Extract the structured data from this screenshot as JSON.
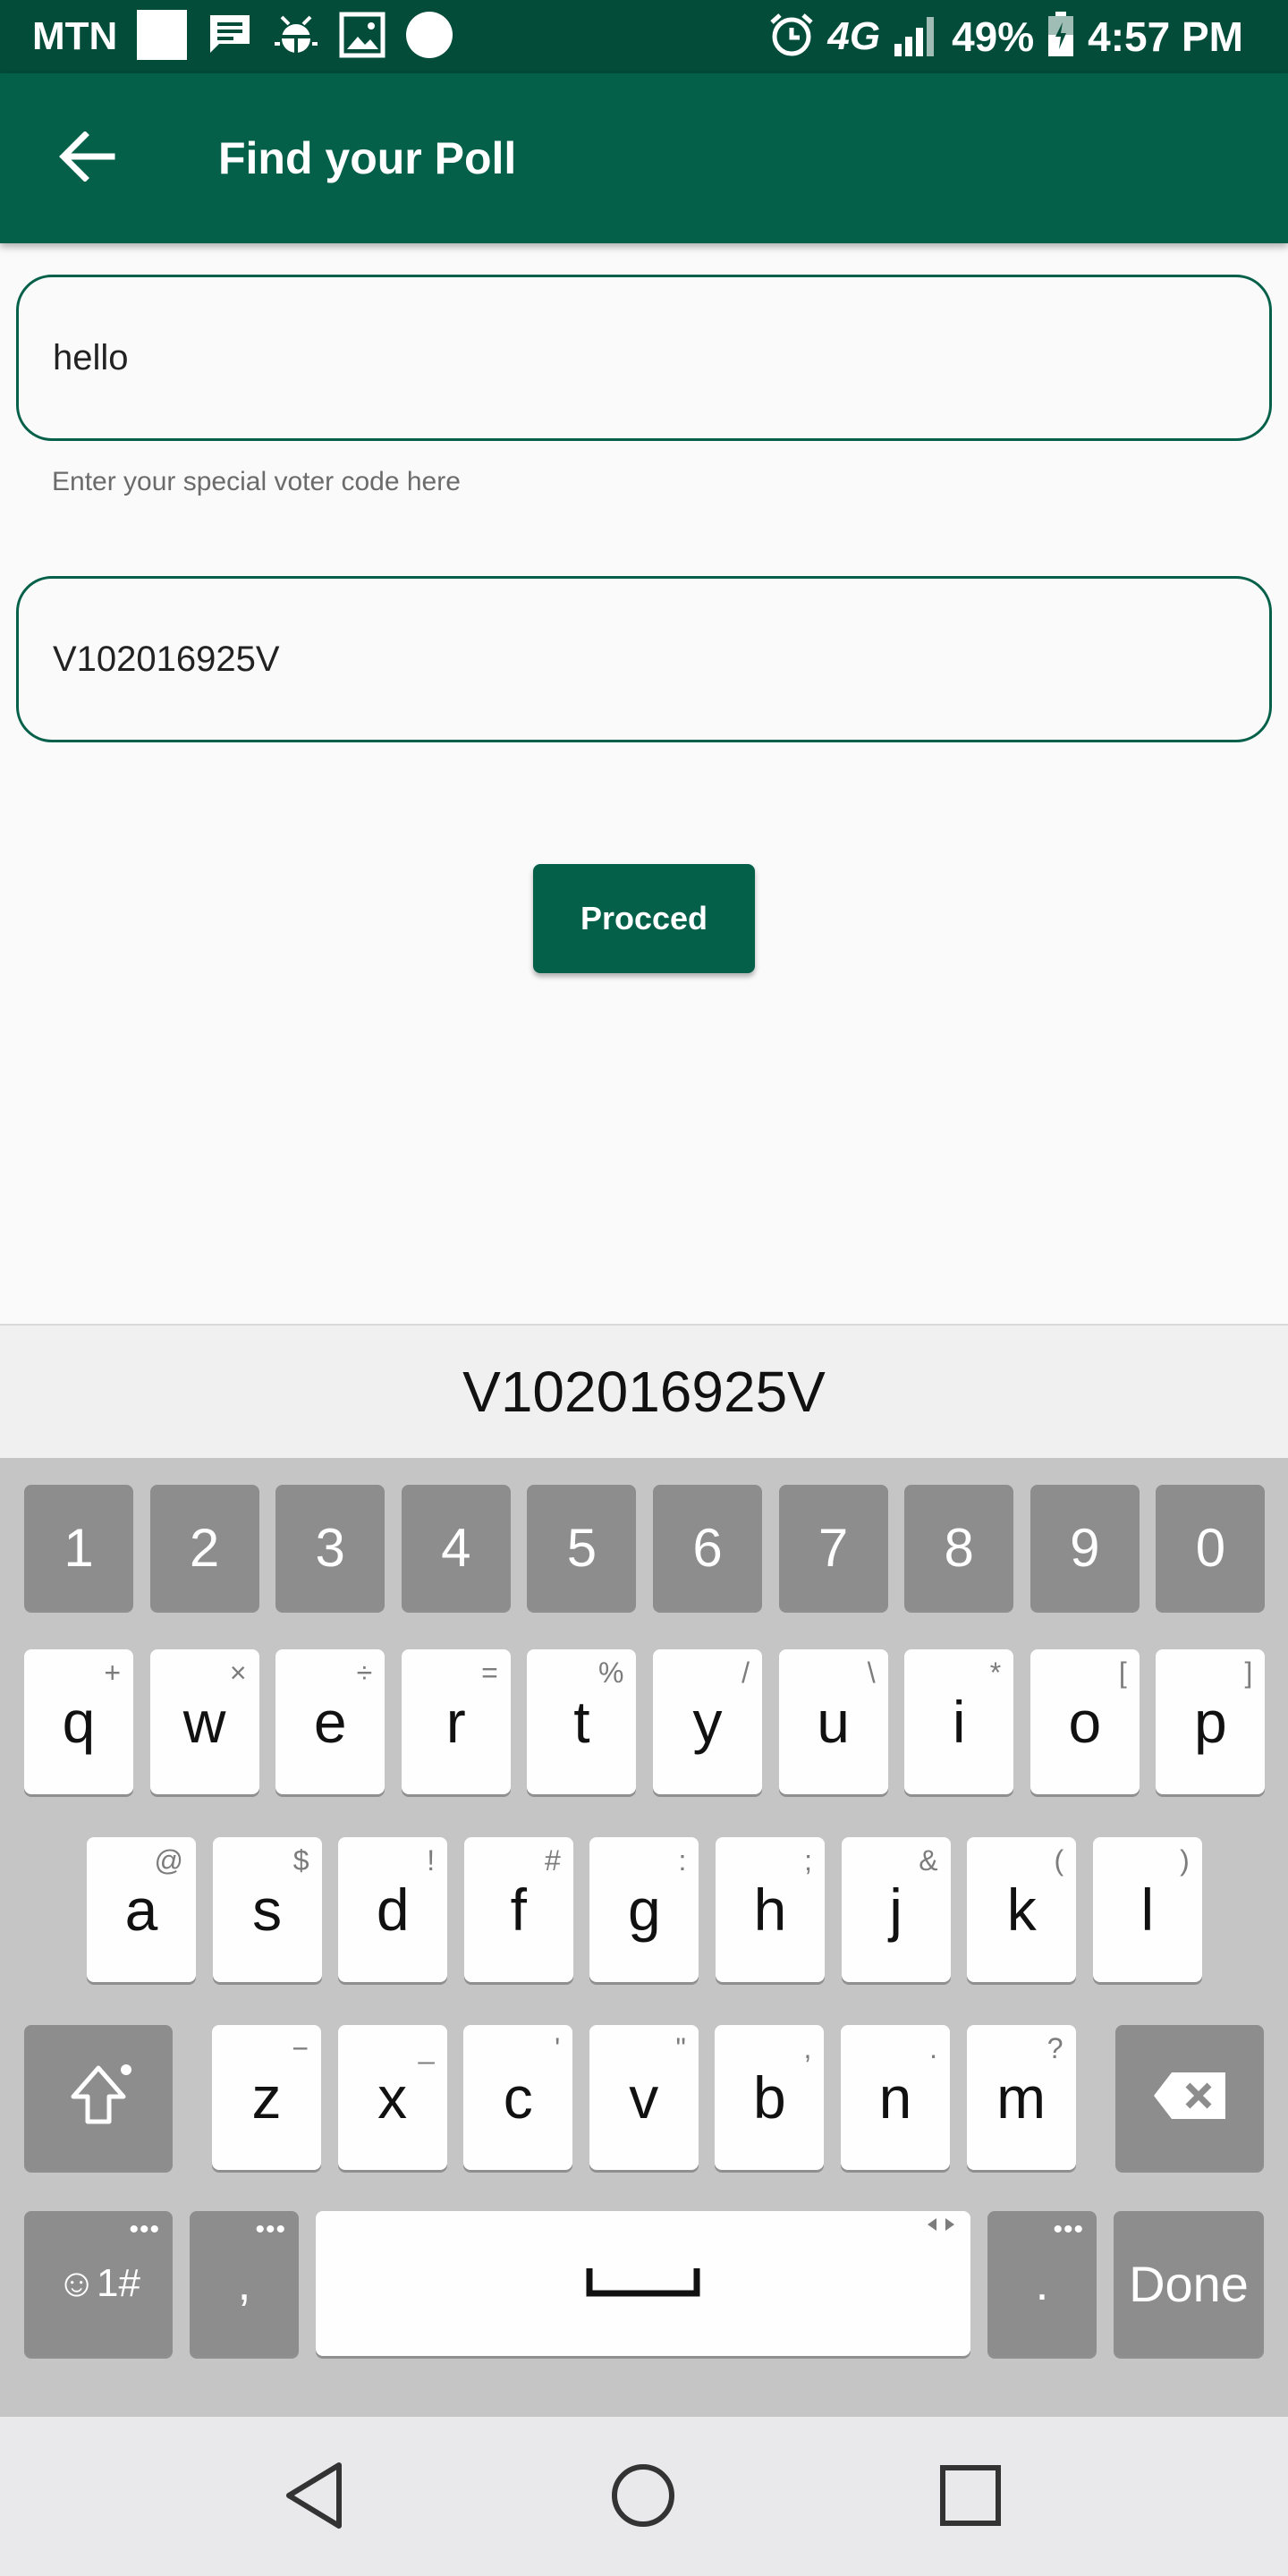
{
  "status_bar": {
    "carrier": "MTN",
    "network": "4G",
    "battery": "49%",
    "time": "4:57 PM"
  },
  "app_bar": {
    "title": "Find your Poll"
  },
  "form": {
    "field1_value": "hello",
    "helper_text": "Enter your special voter code here",
    "field2_value": "V102016925V",
    "proceed_label": "Procced"
  },
  "keyboard": {
    "suggestion": "V102016925V",
    "number_row": [
      "1",
      "2",
      "3",
      "4",
      "5",
      "6",
      "7",
      "8",
      "9",
      "0"
    ],
    "row1": [
      {
        "k": "q",
        "s": "+"
      },
      {
        "k": "w",
        "s": "×"
      },
      {
        "k": "e",
        "s": "÷"
      },
      {
        "k": "r",
        "s": "="
      },
      {
        "k": "t",
        "s": "%"
      },
      {
        "k": "y",
        "s": "/"
      },
      {
        "k": "u",
        "s": "\\"
      },
      {
        "k": "i",
        "s": "*"
      },
      {
        "k": "o",
        "s": "["
      },
      {
        "k": "p",
        "s": "]"
      }
    ],
    "row2": [
      {
        "k": "a",
        "s": "@"
      },
      {
        "k": "s",
        "s": "$"
      },
      {
        "k": "d",
        "s": "!"
      },
      {
        "k": "f",
        "s": "#"
      },
      {
        "k": "g",
        "s": ":"
      },
      {
        "k": "h",
        "s": ";"
      },
      {
        "k": "j",
        "s": "&"
      },
      {
        "k": "k",
        "s": "("
      },
      {
        "k": "l",
        "s": ")"
      }
    ],
    "row3": [
      {
        "k": "z",
        "s": "−"
      },
      {
        "k": "x",
        "s": "_"
      },
      {
        "k": "c",
        "s": "'"
      },
      {
        "k": "v",
        "s": "\""
      },
      {
        "k": "b",
        "s": ","
      },
      {
        "k": "n",
        "s": "."
      },
      {
        "k": "m",
        "s": "?"
      }
    ],
    "symbols_label": "☺1#",
    "comma_label": ",",
    "period_label": ".",
    "done_label": "Done",
    "more_dots": "•••"
  }
}
